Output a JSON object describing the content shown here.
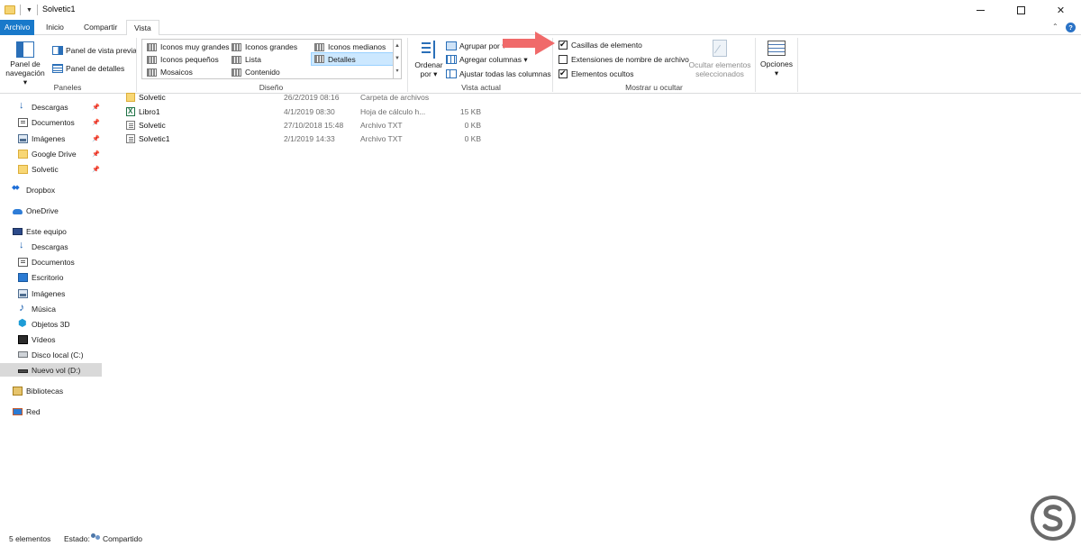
{
  "window": {
    "title": "Solvetic1",
    "controls": {
      "minimize": "minimize-icon",
      "maximize": "maximize-icon",
      "close": "✕"
    }
  },
  "tabs": [
    {
      "label": "Archivo"
    },
    {
      "label": "Inicio"
    },
    {
      "label": "Compartir"
    },
    {
      "label": "Vista"
    }
  ],
  "ribbon": {
    "panes": {
      "nav_pane_line1": "Panel de",
      "nav_pane_line2": "navegación ▾",
      "preview": "Panel de vista previa",
      "details": "Panel de detalles",
      "group": "Paneles"
    },
    "layout": {
      "items": [
        "Iconos muy grandes",
        "Iconos grandes",
        "Iconos medianos",
        "Iconos pequeños",
        "Lista",
        "Detalles",
        "Mosaicos",
        "Contenido"
      ],
      "selected": "Detalles",
      "group": "Diseño"
    },
    "current_view": {
      "sort_line1": "Ordenar",
      "sort_line2": "por ▾",
      "group_by": "Agrupar por ▾",
      "add_columns": "Agregar columnas ▾",
      "fit_columns": "Ajustar todas las columnas",
      "group": "Vista actual"
    },
    "show_hide": {
      "item_checkboxes": "Casillas de elemento",
      "item_checkboxes_checked": true,
      "extensions": "Extensiones de nombre de archivo",
      "extensions_checked": false,
      "hidden_items": "Elementos ocultos",
      "hidden_items_checked": true,
      "hide_selected_line1": "Ocultar elementos",
      "hide_selected_line2": "seleccionados",
      "group": "Mostrar u ocultar"
    },
    "options": {
      "label_line1": "Opciones",
      "label_line2": "▾"
    }
  },
  "nav": {
    "quick_access": [
      {
        "label": "Descargas",
        "icon": "download-icon",
        "pinned": true
      },
      {
        "label": "Documentos",
        "icon": "documents-icon",
        "pinned": true
      },
      {
        "label": "Imágenes",
        "icon": "images-icon",
        "pinned": true
      },
      {
        "label": "Google Drive",
        "icon": "folder-icon",
        "pinned": true
      },
      {
        "label": "Solvetic",
        "icon": "folder-icon",
        "pinned": true
      }
    ],
    "dropbox": "Dropbox",
    "onedrive": "OneDrive",
    "this_pc": "Este equipo",
    "pc_items": [
      {
        "label": "Descargas",
        "icon": "download-icon"
      },
      {
        "label": "Documentos",
        "icon": "documents-icon"
      },
      {
        "label": "Escritorio",
        "icon": "desktop-icon"
      },
      {
        "label": "Imágenes",
        "icon": "images-icon"
      },
      {
        "label": "Música",
        "icon": "music-icon"
      },
      {
        "label": "Objetos 3D",
        "icon": "objects-3d-icon"
      },
      {
        "label": "Vídeos",
        "icon": "videos-icon"
      },
      {
        "label": "Disco local (C:)",
        "icon": "drive-icon"
      },
      {
        "label": "Nuevo vol (D:)",
        "icon": "drive-icon",
        "selected": true
      }
    ],
    "libraries": "Bibliotecas",
    "network": "Red"
  },
  "files": [
    {
      "name": "Solvetic",
      "date": "26/2/2019 08:16",
      "type": "Carpeta de archivos",
      "size": "",
      "icon": "folder-icon"
    },
    {
      "name": "Libro1",
      "date": "4/1/2019 08:30",
      "type": "Hoja de cálculo h...",
      "size": "15 KB",
      "icon": "excel-icon"
    },
    {
      "name": "Solvetic",
      "date": "27/10/2018 15:48",
      "type": "Archivo TXT",
      "size": "0 KB",
      "icon": "text-file-icon"
    },
    {
      "name": "Solvetic1",
      "date": "2/1/2019 14:33",
      "type": "Archivo TXT",
      "size": "0 KB",
      "icon": "text-file-icon"
    }
  ],
  "status": {
    "count": "5 elementos",
    "state_label": "Estado:",
    "state_value": "Compartido"
  },
  "colors": {
    "file_tab": "#1979ca",
    "accent": "#2a6fb8",
    "selected_layout": "#cce8ff",
    "annotation_arrow": "#f06a6a"
  }
}
